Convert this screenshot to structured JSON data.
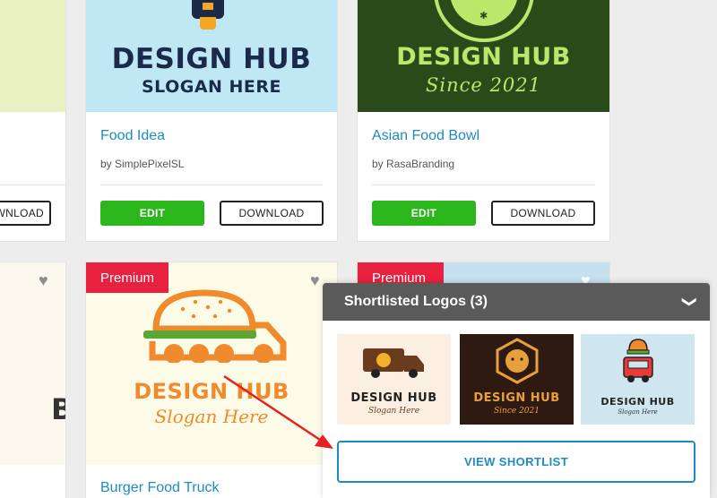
{
  "colors": {
    "link_blue": "#1e8bc3",
    "edit_green": "#2bb61c",
    "premium_red": "#e8213f",
    "panel_header": "#5a5a5a",
    "annotation_arrow": "#e52222"
  },
  "cards": [
    {
      "logo_line1": "DESIGN HUB",
      "logo_line2": "SLOGAN HERE",
      "title": "Food Idea",
      "author": "by SimplePixelSL",
      "edit_label": "EDIT",
      "download_label": "DOWNLOAD"
    },
    {
      "logo_line1": "DESIGN HUB",
      "logo_line2": "Since 2021",
      "title": "Asian Food Bowl",
      "author": "by RasaBranding",
      "edit_label": "EDIT",
      "download_label": "DOWNLOAD"
    },
    {
      "badge": "Premium",
      "logo_line1": "DESIGN HUB",
      "logo_line2": "Slogan Here",
      "title": "Burger Food Truck"
    },
    {
      "badge": "Premium"
    }
  ],
  "left_partial": {
    "download_label": "DOWNLOAD",
    "logo_fragment": "B"
  },
  "shortlist": {
    "title": "Shortlisted Logos (3)",
    "collapse_icon": "chevron-down-icon",
    "items": [
      {
        "logo_line1": "DESIGN HUB",
        "logo_line2": "Slogan Here"
      },
      {
        "logo_line1": "DESIGN HUB",
        "logo_line2": "Since 2021"
      },
      {
        "logo_line1": "DESIGN HUB",
        "logo_line2": "Slogan Here"
      }
    ],
    "view_button": "VIEW SHORTLIST"
  }
}
